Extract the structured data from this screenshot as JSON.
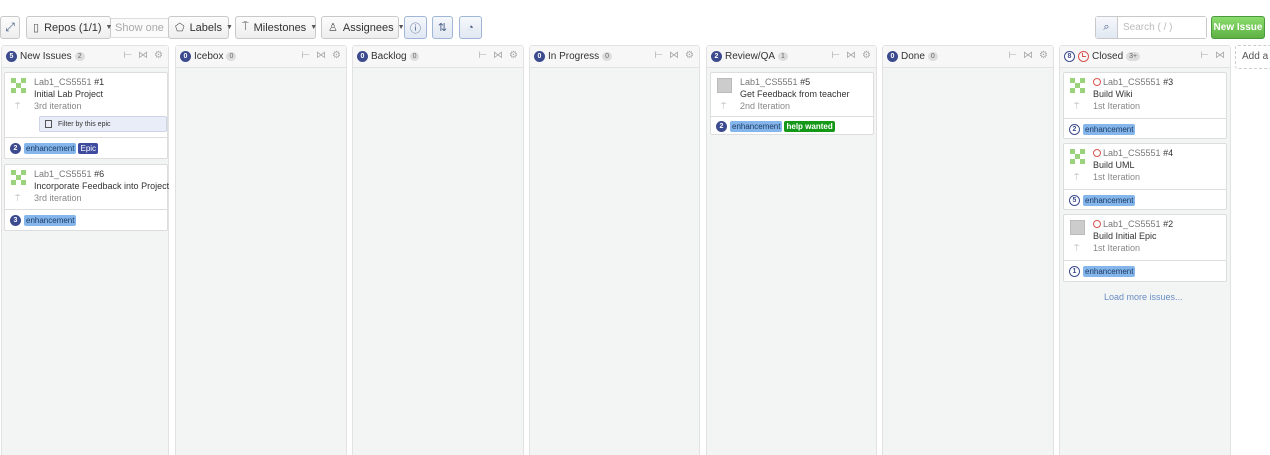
{
  "toolbar": {
    "repos_label": "Repos (1/1)",
    "show_one": "Show one",
    "labels_label": "Labels",
    "milestones_label": "Milestones",
    "assignees_label": "Assignees",
    "search_placeholder": "Search ( / )",
    "new_issue": "New Issue"
  },
  "columns": [
    {
      "title": "New Issues",
      "count": "5",
      "badge": "2"
    },
    {
      "title": "Icebox",
      "count": "0",
      "badge": "0"
    },
    {
      "title": "Backlog",
      "count": "0",
      "badge": "0"
    },
    {
      "title": "In Progress",
      "count": "0",
      "badge": "0"
    },
    {
      "title": "Review/QA",
      "count": "2",
      "badge": "1"
    },
    {
      "title": "Done",
      "count": "0",
      "badge": "0"
    },
    {
      "title": "Closed",
      "count": "8",
      "badge": "3+"
    }
  ],
  "cards": [
    {
      "repo": "Lab1_CS5551",
      "num": "#1",
      "title": "Initial Lab Project",
      "iteration": "3rd iteration",
      "points": "2",
      "filter": "Filter by this epic",
      "labels": [
        "enhancement",
        "Epic"
      ]
    },
    {
      "repo": "Lab1_CS5551",
      "num": "#6",
      "title": "Incorporate Feedback into Project",
      "iteration": "3rd iteration",
      "points": "3",
      "labels": [
        "enhancement"
      ]
    },
    {
      "repo": "Lab1_CS5551",
      "num": "#5",
      "title": "Get Feedback from teacher",
      "iteration": "2nd Iteration",
      "points": "2",
      "labels": [
        "enhancement",
        "help wanted"
      ]
    },
    {
      "repo": "Lab1_CS5551",
      "num": "#3",
      "title": "Build Wiki",
      "iteration": "1st Iteration",
      "points": "2",
      "labels": [
        "enhancement"
      ]
    },
    {
      "repo": "Lab1_CS5551",
      "num": "#4",
      "title": "Build UML",
      "iteration": "1st Iteration",
      "points": "5",
      "labels": [
        "enhancement"
      ]
    },
    {
      "repo": "Lab1_CS5551",
      "num": "#2",
      "title": "Build Initial Epic",
      "iteration": "1st Iteration",
      "points": "1",
      "labels": [
        "enhancement"
      ]
    }
  ],
  "load_more": "Load more issues...",
  "add_column": "Add a",
  "colors": {
    "enhancement": "#84b6eb",
    "epic": "#3e4b9e",
    "help_wanted": "#159818",
    "new_issue": "#60b044",
    "closed": "#d9534f"
  }
}
